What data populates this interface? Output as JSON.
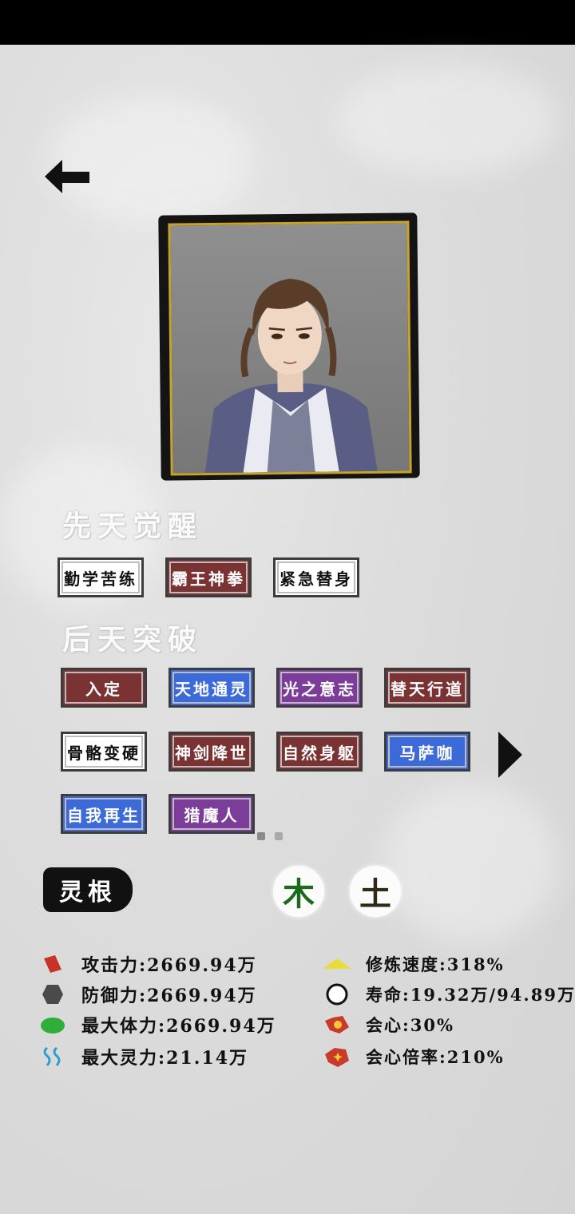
{
  "section_innate": "先天觉醒",
  "section_acquired": "后天突破",
  "innate_tags": [
    {
      "label": "勤学苦练",
      "color": "white"
    },
    {
      "label": "霸王神拳",
      "color": "red"
    },
    {
      "label": "紧急替身",
      "color": "white"
    }
  ],
  "acquired_tags": [
    {
      "label": "入定",
      "color": "red"
    },
    {
      "label": "天地通灵",
      "color": "blue"
    },
    {
      "label": "光之意志",
      "color": "purple"
    },
    {
      "label": "替天行道",
      "color": "red"
    },
    {
      "label": "骨骼变硬",
      "color": "white"
    },
    {
      "label": "神剑降世",
      "color": "red"
    },
    {
      "label": "自然身躯",
      "color": "red"
    },
    {
      "label": "马萨咖",
      "color": "blue"
    },
    {
      "label": "自我再生",
      "color": "blue"
    },
    {
      "label": "猎魔人",
      "color": "purple"
    }
  ],
  "pager": {
    "pages": 2,
    "current": 1
  },
  "spirit_root": {
    "label": "灵根",
    "elements": [
      {
        "char": "木",
        "color": "#1c6b1c"
      },
      {
        "char": "土",
        "color": "#2e2a14"
      }
    ]
  },
  "stats_left": [
    {
      "icon": "attack-icon",
      "text": "攻击力:2669.94万"
    },
    {
      "icon": "defense-icon",
      "text": "防御力:2669.94万"
    },
    {
      "icon": "stamina-icon",
      "text": "最大体力:2669.94万"
    },
    {
      "icon": "spirit-energy-icon",
      "text": "最大灵力:21.14万"
    }
  ],
  "stats_right": [
    {
      "icon": "cultivation-speed-icon",
      "text": "修炼速度:318%"
    },
    {
      "icon": "lifespan-icon",
      "text": "寿命:19.32万/94.89万"
    },
    {
      "icon": "crit-icon",
      "text": "会心:30%"
    },
    {
      "icon": "crit-multiplier-icon",
      "text": "会心倍率:210%"
    }
  ],
  "colors": {
    "tag_white": "#ffffff",
    "tag_red": "#7a3232",
    "tag_blue": "#3c6ad8",
    "tag_purple": "#7c3d9a",
    "frame_gold": "#c9a325"
  }
}
